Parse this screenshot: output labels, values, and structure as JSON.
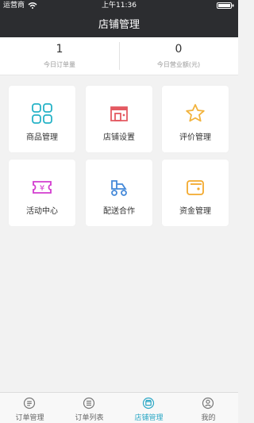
{
  "status_bar": {
    "carrier": "运营商",
    "time": "上午11:36"
  },
  "header": {
    "title": "店铺管理"
  },
  "stats": {
    "orders_today": {
      "value": "1",
      "label": "今日订单量"
    },
    "revenue_today": {
      "value": "0",
      "label": "今日营业额(元)"
    }
  },
  "menu": [
    {
      "label": "商品管理",
      "icon": "grid-icon",
      "color": "#26b3c7"
    },
    {
      "label": "店铺设置",
      "icon": "store-icon",
      "color": "#e45a62"
    },
    {
      "label": "评价管理",
      "icon": "star-icon",
      "color": "#f2b33d"
    },
    {
      "label": "活动中心",
      "icon": "ticket-icon",
      "color": "#d33ccf"
    },
    {
      "label": "配送合作",
      "icon": "delivery-icon",
      "color": "#4489d9"
    },
    {
      "label": "资金管理",
      "icon": "wallet-icon",
      "color": "#f3a92d"
    }
  ],
  "tabs": [
    {
      "label": "订单管理",
      "icon": "order-icon"
    },
    {
      "label": "订单列表",
      "icon": "list-icon"
    },
    {
      "label": "店铺管理",
      "icon": "shop-icon",
      "active": true
    },
    {
      "label": "我的",
      "icon": "profile-icon"
    }
  ],
  "colors": {
    "header_bg": "#2c2d30",
    "page_bg": "#f2f2f2",
    "active_tab": "#2ba7c5"
  }
}
